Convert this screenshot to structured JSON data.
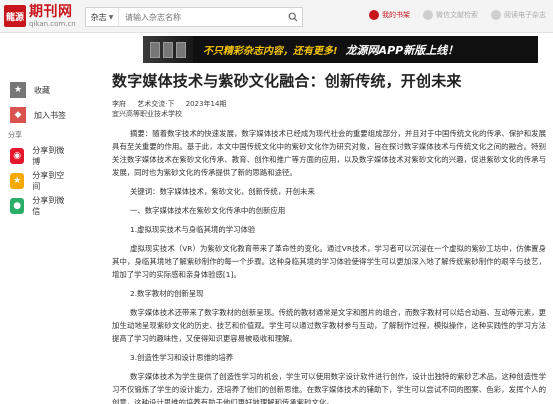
{
  "header": {
    "logo_mark": "龍源",
    "logo_name": "期刊网",
    "logo_domain": "qikan.com.cn",
    "search_category": "杂志",
    "search_placeholder": "请输入杂志名称",
    "my_library": "我的书架",
    "vip_center": "微信文献检索",
    "subscribe": "阅读电子杂志"
  },
  "banner": {
    "text": "不只精彩杂志内容，还有更多!",
    "highlight": "龙源网APP新版上线！"
  },
  "toolbar": {
    "collect": "收藏",
    "bookmark": "加入书签",
    "share_title": "分享",
    "share_weibo": "分享到微博",
    "share_qzone": "分享到空间",
    "share_wechat": "分享到微信"
  },
  "article": {
    "title": "数字媒体技术与紫砂文化融合：创新传统，开创未来",
    "author": "李府",
    "journal": "艺术交流·下",
    "issue": "2023年14期",
    "org": "宜兴高等职业技术学校",
    "abstract": "摘要：随着数字技术的快速发展，数字媒体技术已经成为现代社会的重要组成部分，并且对于中国传统文化的传承、保护和发展具有至关重要的作用。基于此，本文中国传统文化中的紫砂文化作为研究对象，旨在探讨数字媒体技术与传统文化之间的融合。特别关注数字媒体技术在紫砂文化传承、教育、创作和推广等方面的应用，以及数字媒体技术对紫砂文化的兴趣，促进紫砂文化的传承与发展，同时也为紫砂文化的传承提供了新的思路和途径。",
    "keywords": "关键词：数字媒体技术，紫砂文化，创新传统，开创未来",
    "section1": "一、数字媒体技术在紫砂文化传承中的创新应用",
    "sub1": "1.虚拟现实技术与身临其境的学习体验",
    "para1": "虚拟现实技术（VR）为紫砂文化教育带来了革命性的变化。通过VR技术，学习者可以沉浸在一个虚拟的紫砂工坊中，仿佛置身其中，身临其境地了解紫砂制作的每一个步骤。这种身临其境的学习体验使得学生可以更加深入地了解传统紫砂制作的艰辛与技艺，增加了学习的实际感和亲身体验感[1]。",
    "sub2": "2.数字教材的创新呈现",
    "para2": "数字媒体技术还带来了数字教材的创新呈现。传统的教材通常是文字和图片的组合，而数字教材可以结合动画、互动等元素，更加生动地呈现紫砂文化的历史、技艺和价值观。学生可以通过数字教材参与互动，了解制作过程，模拟操作，这种实践性的学习方法提高了学习的趣味性，又使得知识更容易被吸收和理解。",
    "sub3": "3.创造性学习和设计思维的培养",
    "para3": "数字媒体技术为学生提供了创造性学习的机会，学生可以使用数字设计软件进行创作，设计出独特的紫砂艺术品，这种创造性学习不仅锻炼了学生的设计能力，还培养了他们的创新思维。在数字媒体技术的辅助下，学生可以尝试不同的图案、色彩，发挥个人的创意，这种设计思维的培养有助于他们更好地理解和传承紫砂文化。"
  },
  "colors": {
    "brand_red": "#c8161d",
    "banner_yellow": "#f5c400",
    "weibo": "#e6162d",
    "qzone": "#f5a900",
    "wechat": "#2aae67"
  }
}
